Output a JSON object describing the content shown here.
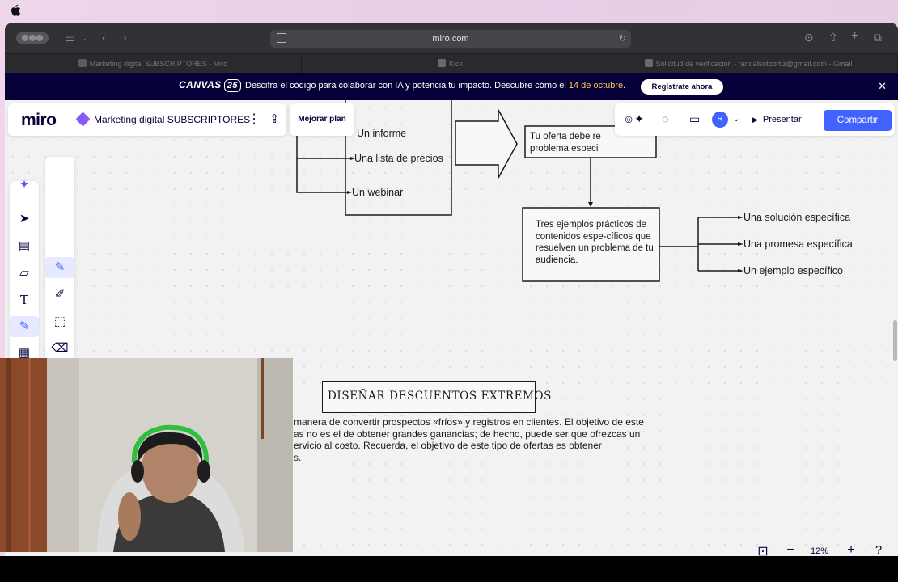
{
  "browser": {
    "url": "miro.com",
    "tabs": [
      {
        "label": "Marketing digital SUBSCRIPTORES - Miro"
      },
      {
        "label": "Kick"
      },
      {
        "label": "Solicitud de verificación - randalsotoortiz@gmail.com - Gmail"
      }
    ]
  },
  "banner": {
    "logo": "CANVAS",
    "logo_badge": "25",
    "text_prefix": "Descifra el código para colaborar con IA y potencia tu impacto. Descubre cómo el ",
    "date": "14 de octubre",
    "text_suffix": ".",
    "cta": "Regístrate ahora"
  },
  "header": {
    "logo": "miro",
    "board_title": "Marketing digital SUBSCRIPTORES",
    "upgrade": "Mejorar plan",
    "avatar": "R",
    "present": "Presentar",
    "share": "Compartir"
  },
  "diagram": {
    "left_items": [
      "Un informe",
      "Una lista de precios",
      "Un webinar"
    ],
    "offer_box": "Tu oferta debe re\nproblema especi",
    "examples_box": "Tres ejemplos prácticos de contenidos espe-cíficos que resuelven un problema de tu audiencia.",
    "right_items": [
      "Una solución específica",
      "Una promesa específica",
      "Un ejemplo específico"
    ],
    "heading": "Diseñar descuentos extremos",
    "paragraph": "manera de convertir prospectos «fríos» y registros en clientes. El objetivo de este\nas no es el de obtener grandes ganancias; de hecho, puede ser que ofrezcas un\nervicio al costo. Recuerda, el objetivo de este tipo de ofertas es obtener\ns."
  },
  "zoom": {
    "value": "12%"
  },
  "colors": {
    "accent": "#4262ff",
    "banner_bg": "#050038",
    "banner_highlight": "#fecd4f"
  }
}
